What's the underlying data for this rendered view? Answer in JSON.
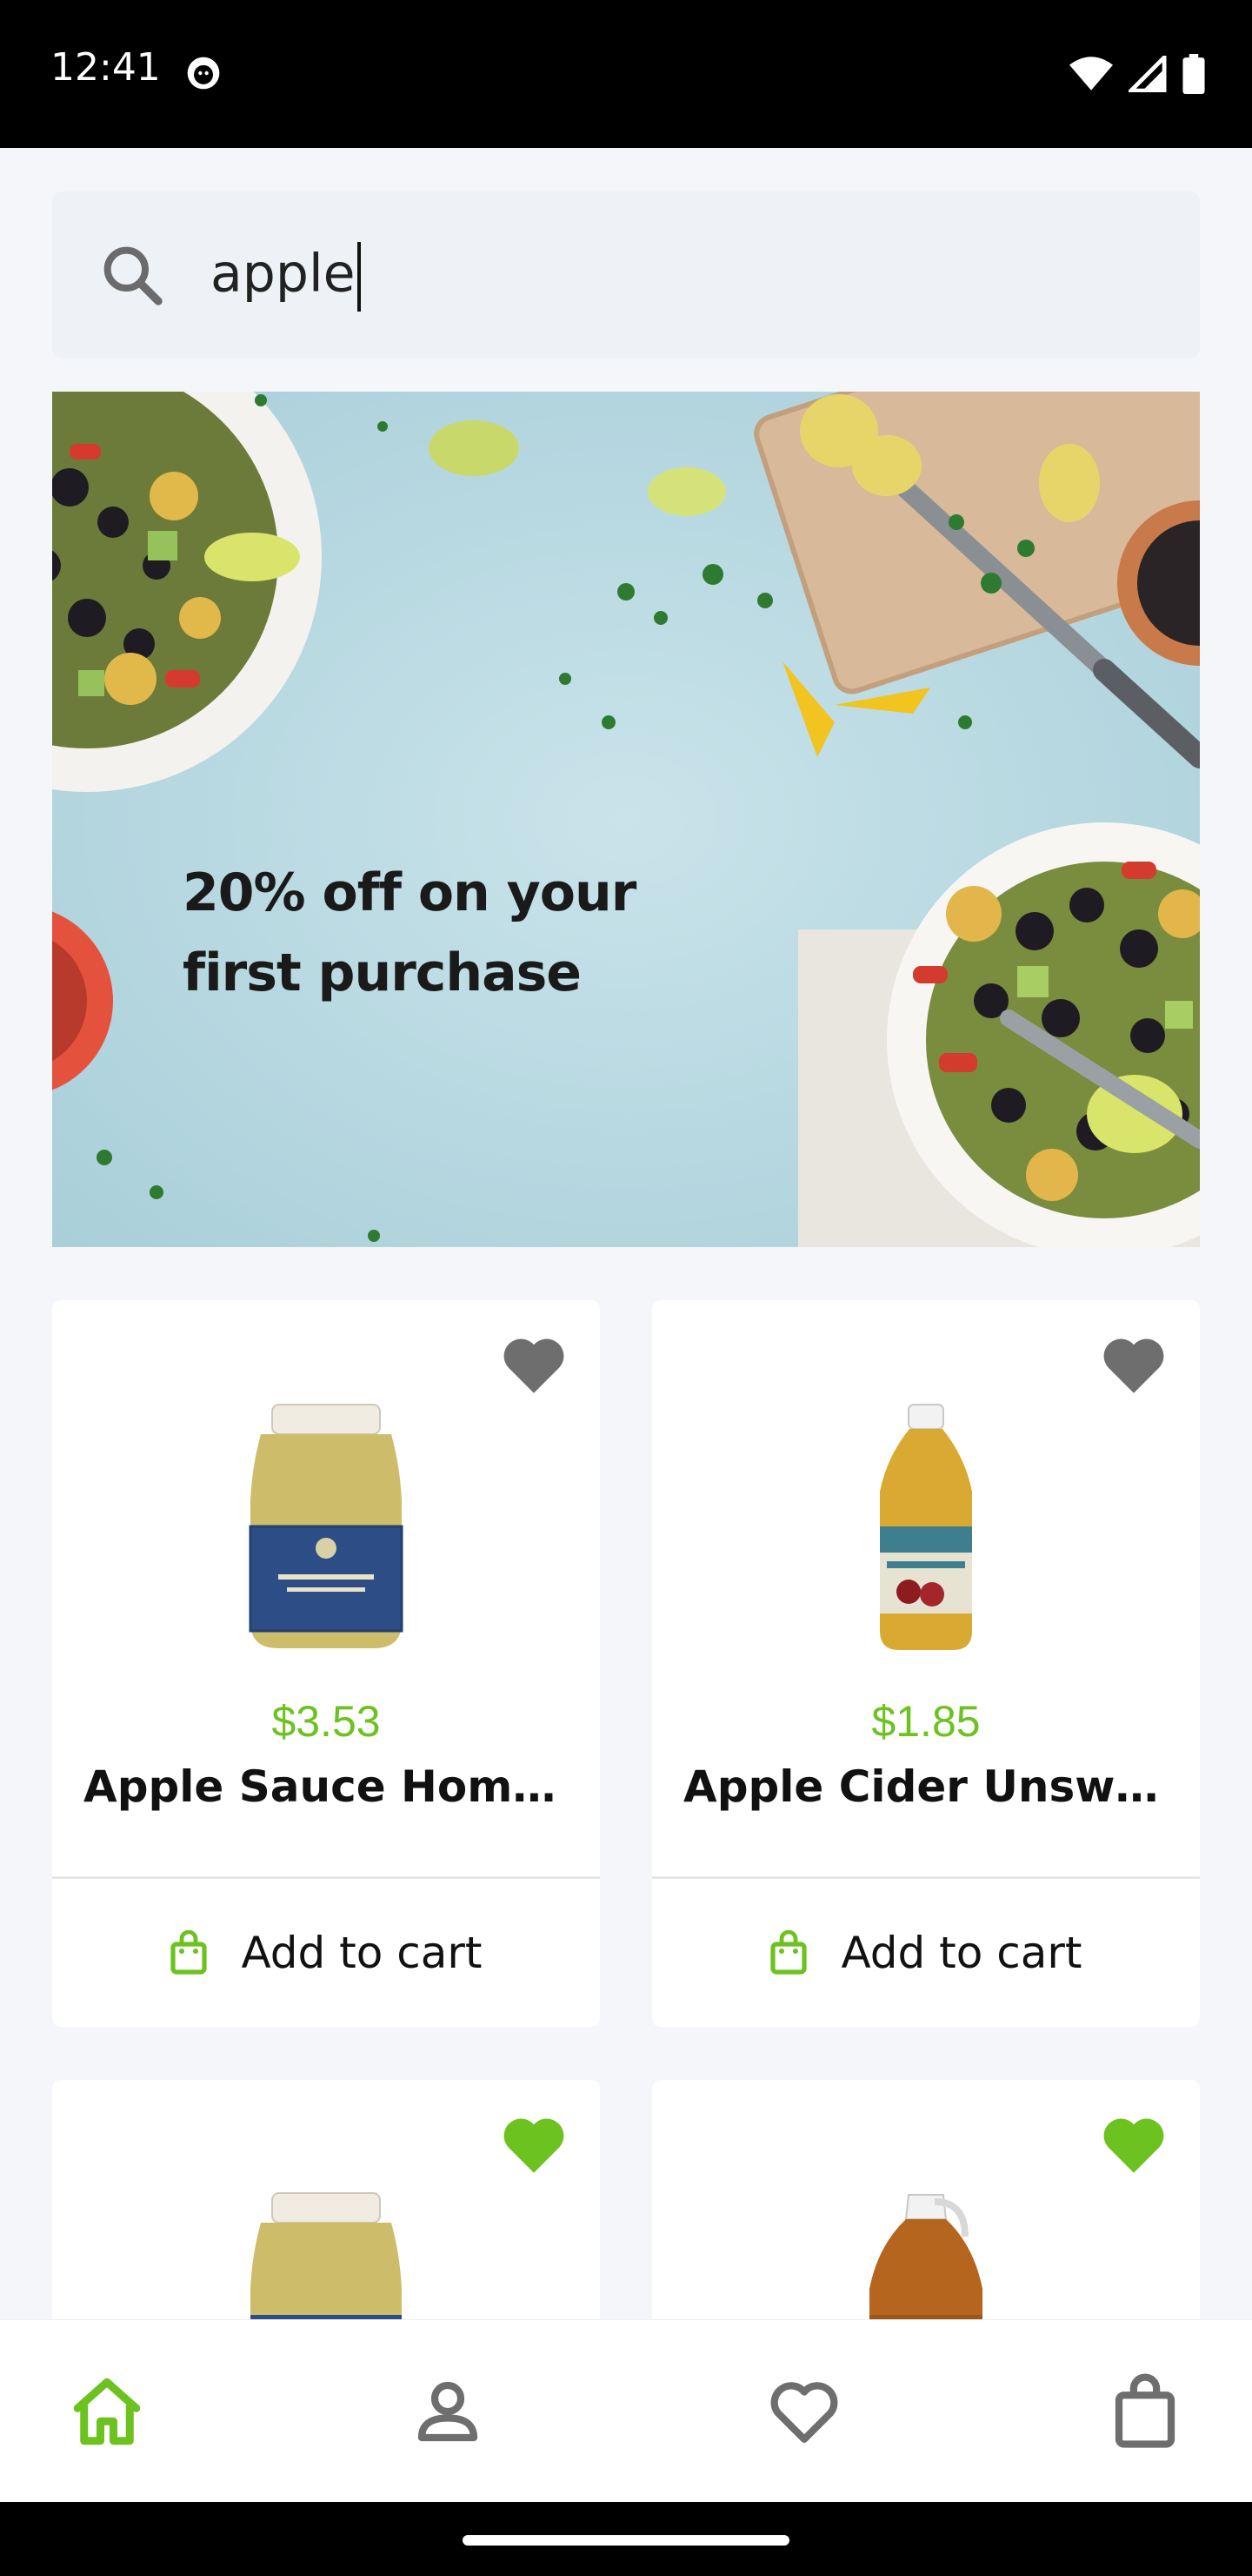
{
  "status_bar": {
    "time": "12:41"
  },
  "search": {
    "value": "apple",
    "icon": "search-icon"
  },
  "banner": {
    "line1": "20% off on your",
    "line2": "first purchase"
  },
  "colors": {
    "accent": "#6cc21f",
    "fav_inactive": "#6e6e6e"
  },
  "products": [
    {
      "price": "$3.53",
      "name": "Apple Sauce Homest…",
      "cart_label": "Add to cart",
      "favorited": false
    },
    {
      "price": "$1.85",
      "name": "Apple Cider Unsweet…",
      "cart_label": "Add to cart",
      "favorited": false
    },
    {
      "price": "",
      "name": "",
      "cart_label": "",
      "favorited": true
    },
    {
      "price": "",
      "name": "",
      "cart_label": "",
      "favorited": true
    }
  ],
  "bottom_nav": [
    {
      "icon": "home-icon",
      "active": true
    },
    {
      "icon": "profile-icon",
      "active": false
    },
    {
      "icon": "heart-icon",
      "active": false
    },
    {
      "icon": "shopping-bag-icon",
      "active": false
    }
  ]
}
